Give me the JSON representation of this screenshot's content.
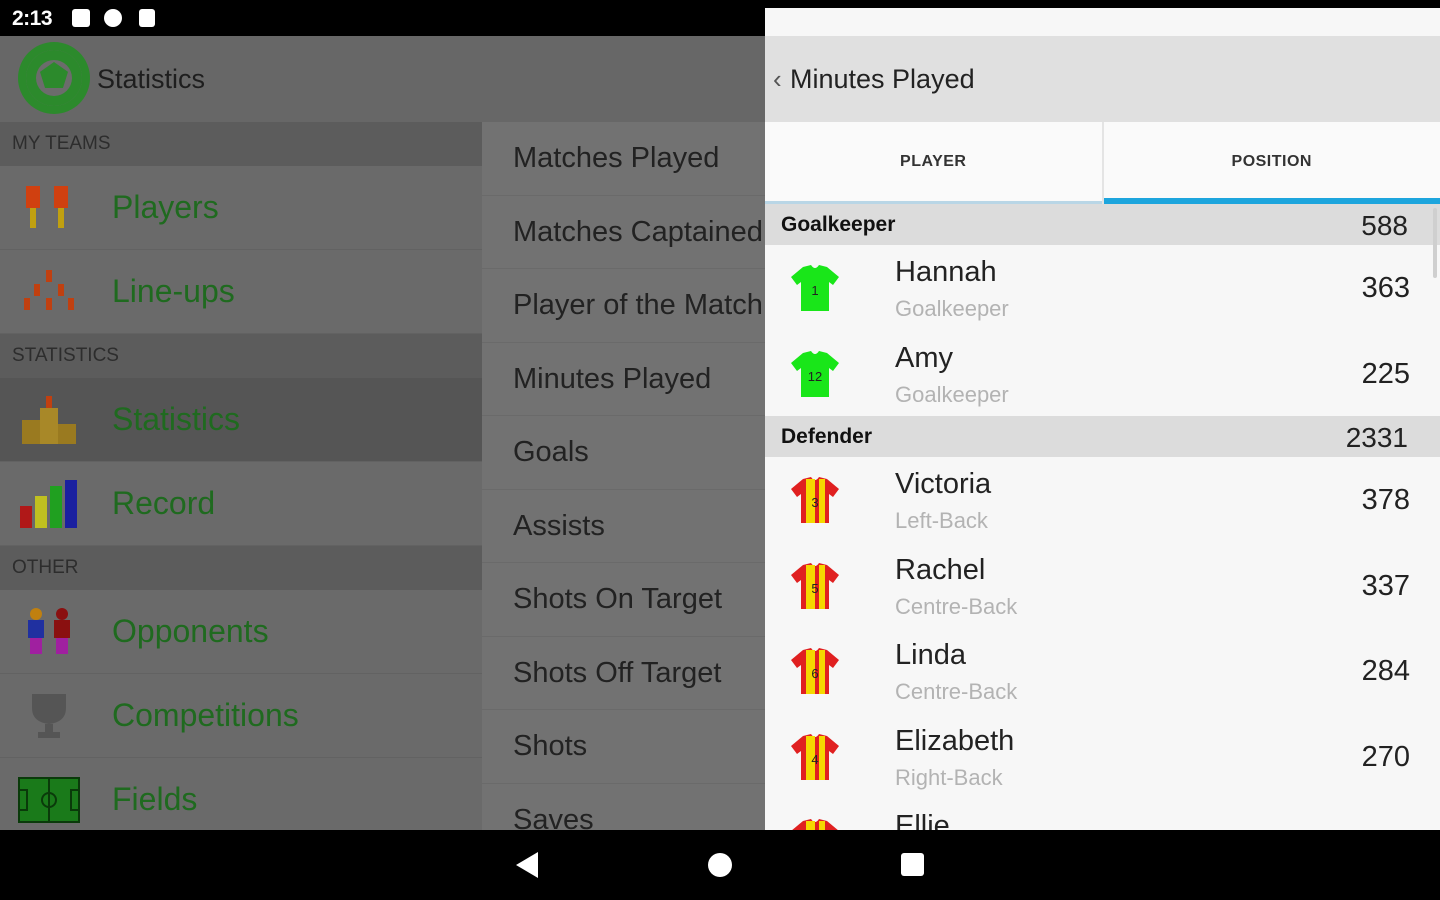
{
  "status_bar": {
    "time": "2:13"
  },
  "app": {
    "title": "Statistics"
  },
  "drawer": {
    "sections": [
      {
        "header": "MY TEAMS",
        "items": [
          {
            "label": "Players",
            "icon": "players-icon"
          },
          {
            "label": "Line-ups",
            "icon": "lineups-icon"
          }
        ]
      },
      {
        "header": "STATISTICS",
        "items": [
          {
            "label": "Statistics",
            "icon": "statistics-podium-icon",
            "selected": true
          },
          {
            "label": "Record",
            "icon": "bar-chart-icon"
          }
        ]
      },
      {
        "header": "OTHER",
        "items": [
          {
            "label": "Opponents",
            "icon": "opponents-icon"
          },
          {
            "label": "Competitions",
            "icon": "trophy-icon"
          },
          {
            "label": "Fields",
            "icon": "field-icon"
          }
        ]
      }
    ]
  },
  "stat_menu": {
    "items": [
      "Matches Played",
      "Matches Captained",
      "Player of the Match",
      "Minutes Played",
      "Goals",
      "Assists",
      "Shots On Target",
      "Shots Off Target",
      "Shots",
      "Saves"
    ]
  },
  "detail": {
    "back_glyph": "‹",
    "title": "Minutes Played",
    "tabs": [
      {
        "label": "PLAYER",
        "active": false
      },
      {
        "label": "POSITION",
        "active": true
      }
    ],
    "groups": [
      {
        "name": "Goalkeeper",
        "total": "588",
        "players": [
          {
            "name": "Hannah",
            "position": "Goalkeeper",
            "value": "363",
            "number": "1",
            "kit": "green"
          },
          {
            "name": "Amy",
            "position": "Goalkeeper",
            "value": "225",
            "number": "12",
            "kit": "green"
          }
        ]
      },
      {
        "name": "Defender",
        "total": "2331",
        "players": [
          {
            "name": "Victoria",
            "position": "Left-Back",
            "value": "378",
            "number": "3",
            "kit": "red-yellow"
          },
          {
            "name": "Rachel",
            "position": "Centre-Back",
            "value": "337",
            "number": "5",
            "kit": "red-yellow"
          },
          {
            "name": "Linda",
            "position": "Centre-Back",
            "value": "284",
            "number": "6",
            "kit": "red-yellow"
          },
          {
            "name": "Elizabeth",
            "position": "Right-Back",
            "value": "270",
            "number": "4",
            "kit": "red-yellow"
          },
          {
            "name": "Ellie",
            "position": "",
            "value": "",
            "number": "",
            "kit": "red-yellow"
          }
        ]
      }
    ]
  },
  "colors": {
    "accent": "#1da5dd",
    "nav_label": "#1f6a1f",
    "keeper_kit": "#19e619",
    "kit_red": "#e02020",
    "kit_yellow": "#f5d800"
  }
}
